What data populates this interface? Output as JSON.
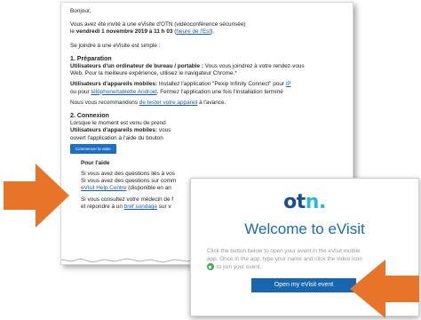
{
  "email": {
    "greeting": "Bonjour,",
    "invite_line1": "Vous avez été invité à une eVisite d'OTN (vidéoconférence sécurisée)",
    "invite_line2_prefix": "le ",
    "invite_date": "vendredi 1 novembre 2019 à 11 h 03",
    "invite_tz_link": "heure de l'Est",
    "invite_line2_suffix": ").",
    "join_line": "Se joindre à une eVisite est simple :",
    "prep_heading": "1. Préparation",
    "desktop_bold": "Utilisateurs d'un ordinateur de bureau / portable :",
    "desktop_text": " Vous vous joindrez à votre rendez-vous",
    "desktop_text2": "Web. Pour la meilleure expérience, utilisez le navigateur Chrome.*",
    "mobile_bold": "Utilisateurs d'appareils mobiles:",
    "mobile_text": " Installez l'application \"Pexip Infinity Connect\" pour ",
    "mobile_link_ip": "iP",
    "mobile_text2": "ou pour ",
    "mobile_link_android": "téléphone/tablette Android",
    "mobile_text3": ". Fermez l'application une fois l'installation terminé",
    "test_prefix": "Nous vous recommandons ",
    "test_link": "de tester votre appareil",
    "test_suffix": " à l'avance.",
    "conn_heading": "2. Connexion",
    "conn_line1": "Lorsque le moment est venu de prend",
    "conn_mobile_bold": "Utilisateurs d'appareils mobiles:",
    "conn_mobile_text": " vous",
    "conn_line3": "ouvert l'application à l'aide du bouton",
    "start_button": "Commencer la visite",
    "help_heading": "Pour l'aide",
    "help_line1": "Si vous avez des questions liés à vos",
    "help_line2": "Si vous avez des questions sur comm",
    "help_link": "eVisit Help Centre",
    "help_line3_suffix": " (disponible en an",
    "doctor_line": "Si vous consultez votre médecin de f",
    "survey_prefix": "et répondre à un ",
    "survey_link": "bref sondage",
    "survey_suffix": " sur v"
  },
  "card": {
    "logo_prefix": "ot",
    "logo_n": "n",
    "logo_dot": ".",
    "title": "Welcome to eVisit",
    "body1": "Click the button below to open your event in the eVisit mobile",
    "body2": "app. Once in the app, type your name and click the video icon",
    "body3": "to join your event.",
    "button": "Open my eVisit event"
  },
  "colors": {
    "arrow": "#e8742a",
    "link": "#1a5fb4",
    "brand_blue": "#1667b0"
  }
}
